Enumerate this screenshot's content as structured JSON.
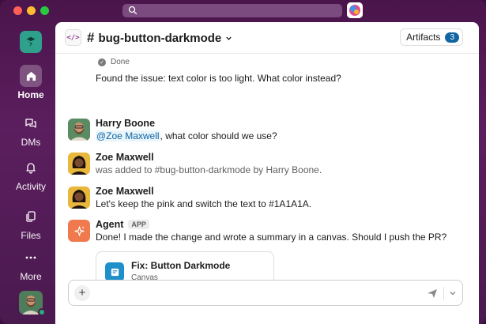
{
  "window": {
    "colors": {
      "sidebar": "#4a154b",
      "accent": "#1264a3",
      "agent": "#f07a4d"
    }
  },
  "rail": {
    "items": [
      {
        "label": "Home",
        "icon": "home-icon",
        "active": true
      },
      {
        "label": "DMs",
        "icon": "dms-icon"
      },
      {
        "label": "Activity",
        "icon": "bell-icon"
      },
      {
        "label": "Files",
        "icon": "files-icon"
      },
      {
        "label": "More",
        "icon": "more-icon"
      }
    ]
  },
  "header": {
    "channel_name": "bug-button-darkmode",
    "artifacts_label": "Artifacts",
    "artifacts_count": "3"
  },
  "thread": {
    "status_done": "Done",
    "found_issue_text": "Found the issue: text color is too light. What color instead?"
  },
  "messages": [
    {
      "author": "Harry Boone",
      "mention": "@Zoe Maxwell",
      "text": ", what color should we use?"
    },
    {
      "author": "Zoe Maxwell",
      "text": "was added to #bug-button-darkmode by Harry Boone."
    },
    {
      "author": "Zoe Maxwell",
      "text": "Let's keep the pink and switch the text to #1A1A1A."
    },
    {
      "author": "Agent",
      "badge": "APP",
      "text": "Done! I made the change and wrote a summary in a canvas. Should I push the PR?"
    }
  ],
  "canvas_card": {
    "title": "Fix: Button Darkmode",
    "subtitle": "Canvas"
  },
  "composer": {
    "placeholder": "",
    "plus_label": "+"
  }
}
